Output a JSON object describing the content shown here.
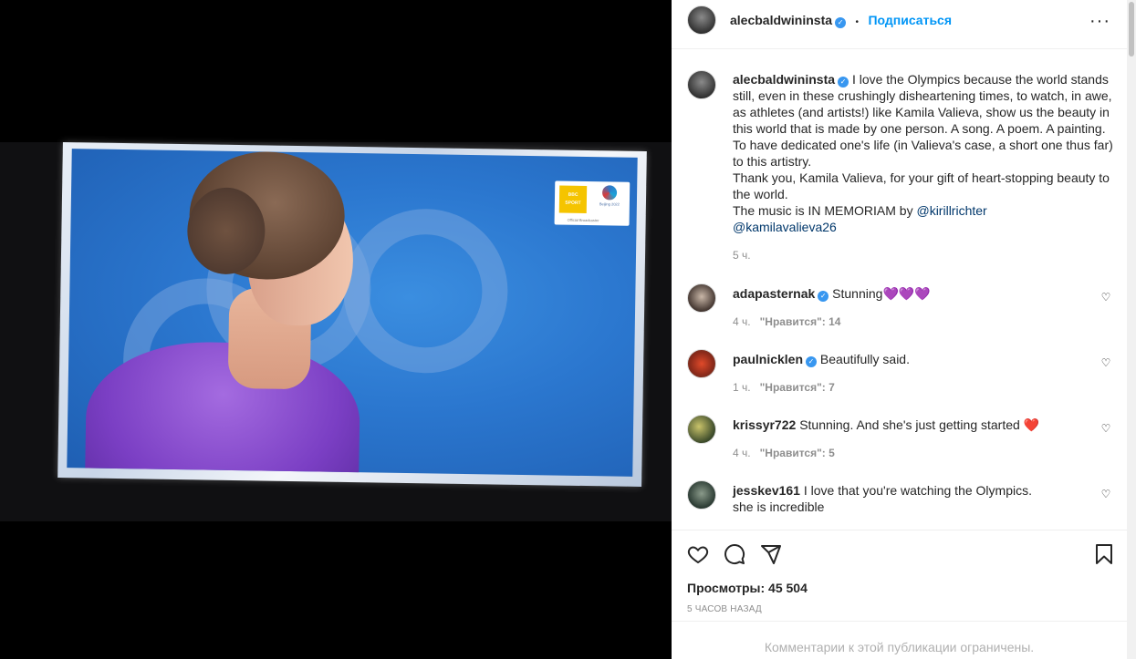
{
  "media": {
    "logo_line1": "BBC",
    "logo_line2": "SPORT",
    "games_label": "Beijing 2022",
    "broadcaster_label": "Official Broadcaster"
  },
  "header": {
    "username": "alecbaldwininsta",
    "follow_label": "Подписаться",
    "separator": "•",
    "more_label": "···"
  },
  "caption": {
    "username": "alecbaldwininsta",
    "text_lines": [
      "I love the Olympics because the world stands",
      "still, even in these crushingly disheartening times, to watch, in awe,",
      "as athletes (and artists!) like Kamila Valieva, show us the beauty in",
      "this world that is made by one person. A song. A poem. A painting.",
      "To have dedicated one's life (in Valieva's case, a short one thus far)",
      "to this artistry.",
      "Thank you, Kamila Valieva, for your gift of heart-stopping beauty to",
      "the world.",
      "The music is IN MEMORIAM by"
    ],
    "mention1": "@kirillrichter",
    "mention2": "@kamilavalieva26",
    "time": "5 ч."
  },
  "comments": [
    {
      "username": "adapasternak",
      "verified": true,
      "text": "Stunning💜💜💜",
      "time": "4 ч.",
      "likes": "\"Нравится\": 14"
    },
    {
      "username": "paulnicklen",
      "verified": true,
      "text": "Beautifully said.",
      "time": "1 ч.",
      "likes": "\"Нравится\": 7"
    },
    {
      "username": "krissyr722",
      "verified": false,
      "text": "Stunning. And she's just getting started ❤️",
      "time": "4 ч.",
      "likes": "\"Нравится\": 5"
    },
    {
      "username": "jesskev161",
      "verified": false,
      "text": "I love that you're watching the Olympics.",
      "text2": "she is incredible"
    }
  ],
  "footer": {
    "views": "Просмотры: 45 504",
    "posted_ago": "5 ЧАСОВ НАЗАД",
    "comments_limited": "Комментарии к этой публикации ограничены."
  },
  "colors": {
    "accent": "#0095f6",
    "verified": "#3897f0",
    "muted": "#8e8e8e"
  }
}
